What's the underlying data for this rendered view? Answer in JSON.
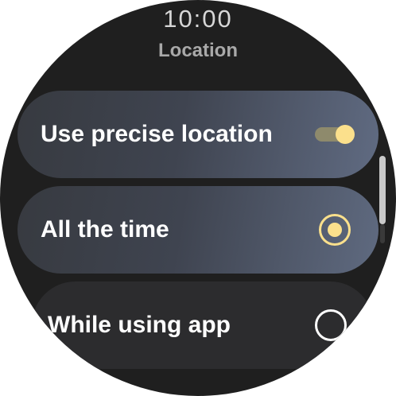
{
  "status": {
    "time": "10:00"
  },
  "header": {
    "title": "Location"
  },
  "settings": {
    "precise_location": {
      "label": "Use precise location",
      "enabled": true
    },
    "access_options": [
      {
        "label": "All the time",
        "selected": true
      },
      {
        "label": "While using app",
        "selected": false
      }
    ]
  },
  "colors": {
    "accent": "#fbe08c",
    "background": "#1f1f1f",
    "chip_inactive": "#2c2c2e"
  }
}
